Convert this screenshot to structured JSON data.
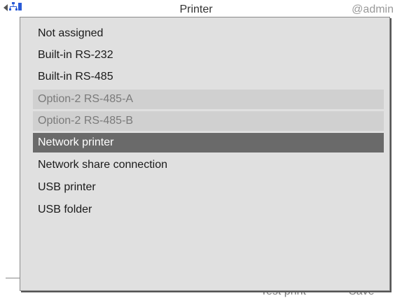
{
  "header": {
    "title": "Printer",
    "user": "@admin",
    "icons": [
      "back-arrow-icon",
      "network-icon"
    ]
  },
  "background_buttons": {
    "test_print": "Test print",
    "save": "Save"
  },
  "dropdown": {
    "options": [
      {
        "label": "Not assigned",
        "state": "normal"
      },
      {
        "label": "Built-in RS-232",
        "state": "normal"
      },
      {
        "label": "Built-in RS-485",
        "state": "normal"
      },
      {
        "label": "Option-2 RS-485-A",
        "state": "disabled"
      },
      {
        "label": "Option-2 RS-485-B",
        "state": "disabled"
      },
      {
        "label": "Network printer",
        "state": "selected"
      },
      {
        "label": "Network share connection",
        "state": "normal"
      },
      {
        "label": "USB printer",
        "state": "normal"
      },
      {
        "label": "USB folder",
        "state": "normal"
      }
    ]
  },
  "colors": {
    "popup_bg": "#e0e0e0",
    "disabled_bg": "#d0d0d0",
    "selected_bg": "#6a6a6a",
    "icon_blue": "#2a5bd7"
  }
}
